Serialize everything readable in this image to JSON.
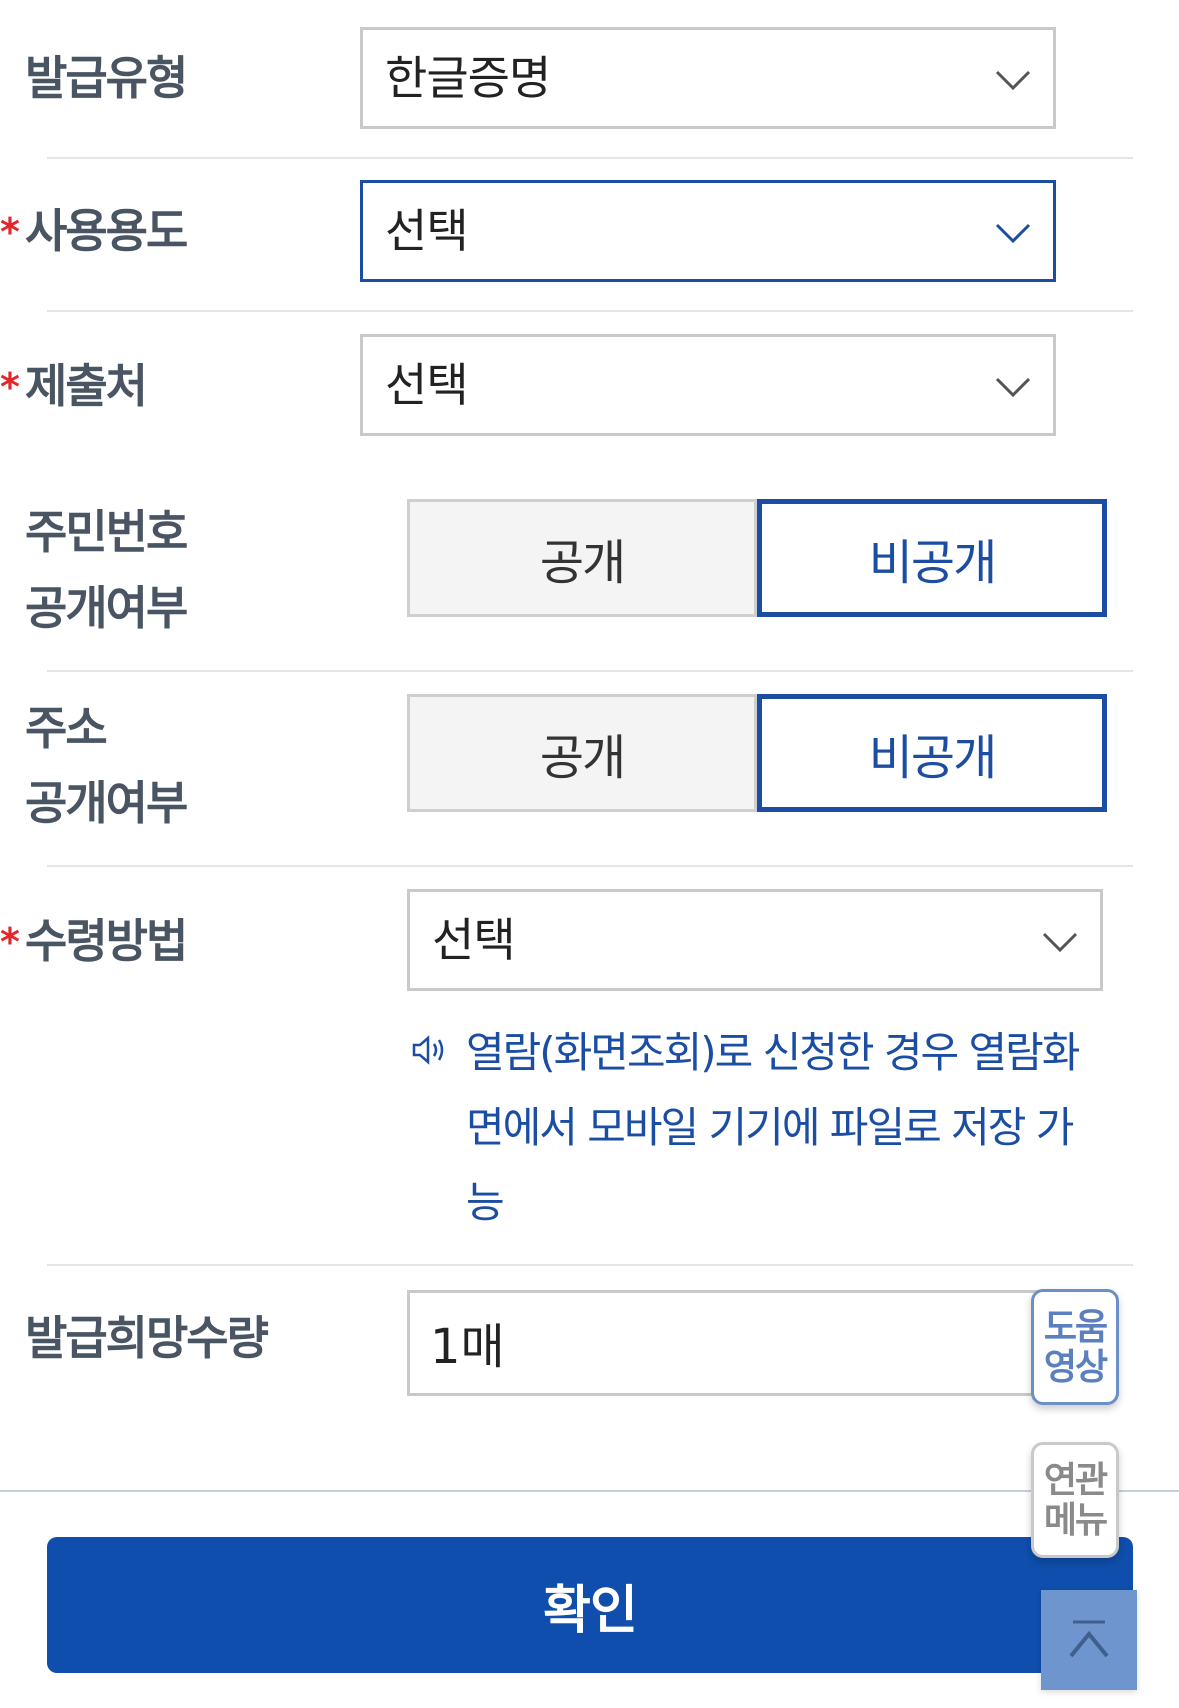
{
  "fields": {
    "issue_type": {
      "label": "발급유형",
      "value": "한글증명"
    },
    "usage": {
      "required_mark": "*",
      "label": "사용용도",
      "value": "선택"
    },
    "submit_to": {
      "required_mark": "*",
      "label": "제출처",
      "value": "선택"
    },
    "rrn_disclosure": {
      "label_line1": "주민번호",
      "label_line2": "공개여부",
      "options": [
        "공개",
        "비공개"
      ],
      "selected": "비공개"
    },
    "address_disclosure": {
      "label_line1": "주소",
      "label_line2": "공개여부",
      "options": [
        "공개",
        "비공개"
      ],
      "selected": "비공개"
    },
    "receive_method": {
      "required_mark": "*",
      "label": "수령방법",
      "value": "선택",
      "notice": "열람(화면조회)로 신청한 경우 열람화면에서 모바일 기기에 파일로 저장 가능"
    },
    "quantity": {
      "label": "발급희망수량",
      "value": "1매"
    }
  },
  "floating": {
    "help_video": {
      "line1": "도움",
      "line2": "영상"
    },
    "related_menu": {
      "line1": "연관",
      "line2": "메뉴"
    }
  },
  "confirm_label": "확인",
  "colors": {
    "accent": "#1b4ea3",
    "button": "#0f4eac",
    "required": "#e3262b"
  }
}
